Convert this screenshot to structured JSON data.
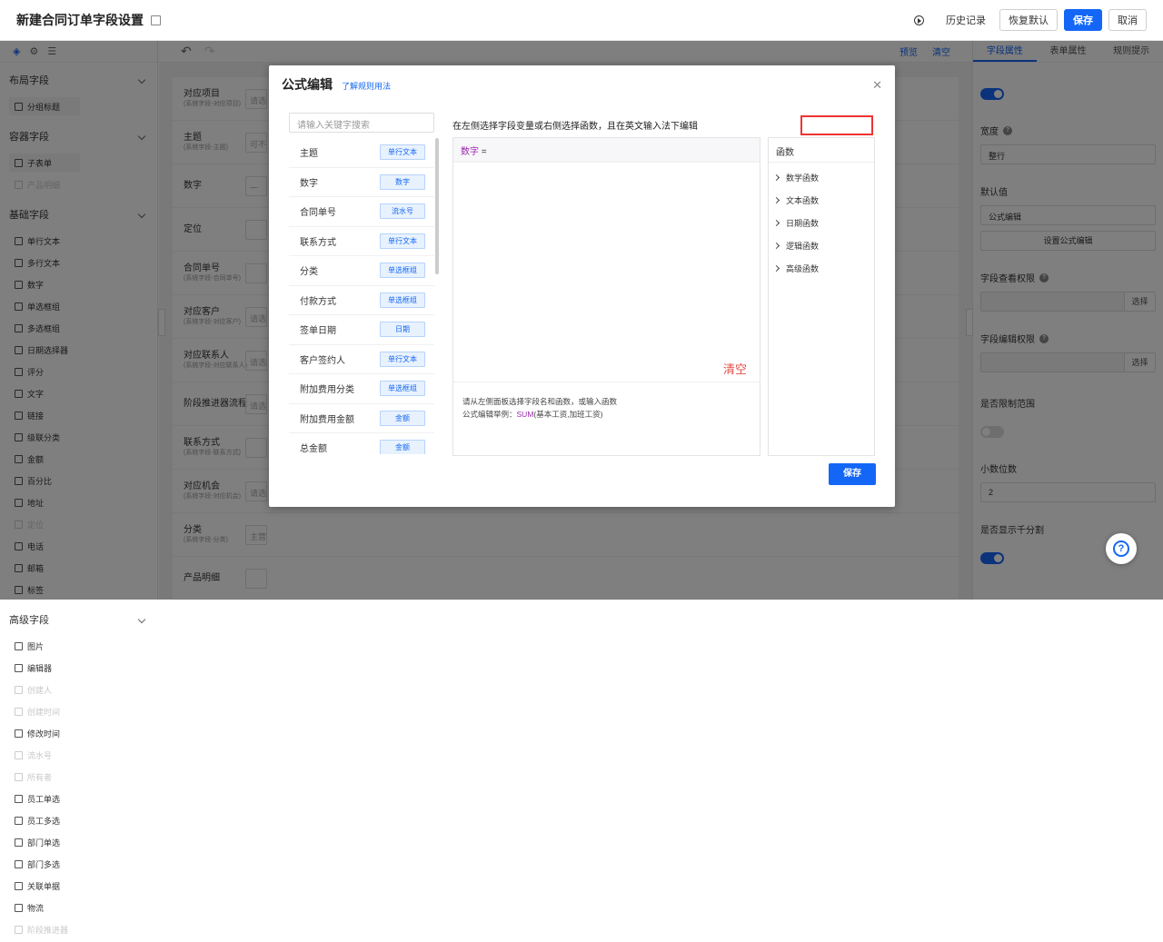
{
  "header": {
    "title": "新建合同订单字段设置",
    "history": "历史记录",
    "restore": "恢复默认",
    "save": "保存",
    "cancel": "取消"
  },
  "left_panel": {
    "groups": [
      {
        "title": "布局字段",
        "items": [
          "分组标题"
        ]
      },
      {
        "title": "容器字段",
        "items": [
          "子表单",
          "产品明细"
        ]
      },
      {
        "title": "基础字段",
        "items": [
          "单行文本",
          "多行文本",
          "数字",
          "单选框组",
          "多选框组",
          "日期选择器",
          "评分",
          "文字",
          "链接",
          "级联分类",
          "金额",
          "百分比",
          "地址",
          "定位",
          "电话",
          "邮箱",
          "标签"
        ]
      },
      {
        "title": "高级字段",
        "items": [
          "图片",
          "编辑器",
          "创建人",
          "创建时间",
          "修改时间",
          "流水号",
          "所有者",
          "员工单选",
          "员工多选",
          "部门单选",
          "部门多选",
          "关联单据",
          "物流",
          "阶段推进器"
        ]
      }
    ]
  },
  "toolbar": {
    "preview": "预览",
    "clear": "清空"
  },
  "form_rows": [
    {
      "label": "对应项目",
      "sub": "(系统字段-对应项目)",
      "value": "请选"
    },
    {
      "label": "主题",
      "sub": "(系统字段-主题)",
      "value": "可不"
    },
    {
      "label": "数字",
      "sub": "",
      "value": "一"
    },
    {
      "label": "定位",
      "sub": "",
      "value": ""
    },
    {
      "label": "合同单号",
      "sub": "(系统字段-合同单号)",
      "value": ""
    },
    {
      "label": "对应客户",
      "sub": "(系统字段-对应客户)",
      "value": "请选"
    },
    {
      "label": "对应联系人",
      "sub": "(系统字段-对应联系人)",
      "value": "请选"
    },
    {
      "label": "阶段推进器流程",
      "sub": "",
      "value": "请选"
    },
    {
      "label": "联系方式",
      "sub": "(系统字段-联系方式)",
      "value": ""
    },
    {
      "label": "对应机会",
      "sub": "(系统字段-对应机会)",
      "value": "请选择"
    },
    {
      "label": "分类",
      "sub": "(系统字段-分类)",
      "value": "主营产品销售"
    },
    {
      "label": "产品明细",
      "sub": "",
      "value": ""
    }
  ],
  "right_panel": {
    "tabs": [
      "字段属性",
      "表单属性",
      "规则提示"
    ],
    "width_label": "宽度",
    "width_value": "整行",
    "default_label": "默认值",
    "default_value": "公式编辑",
    "set_formula": "设置公式编辑",
    "view_perm": "字段查看权限",
    "edit_perm": "字段编辑权限",
    "pick": "选择",
    "limit_label": "是否限制范围",
    "decimal_label": "小数位数",
    "decimal_value": "2",
    "thousands_label": "是否显示千分割"
  },
  "modal": {
    "title": "公式编辑",
    "help_link": "了解规则用法",
    "search_placeholder": "请输入关键字搜索",
    "hint": "在左侧选择字段变量或右侧选择函数，且在英文输入法下编辑",
    "formula_var": "数字",
    "formula_eq": "=",
    "clear": "清空",
    "help_line1": "请从左侧面板选择字段名和函数，或输入函数",
    "help_line2_prefix": "公式编辑举例：",
    "help_line2_fx": "SUM",
    "help_line2_args": "(基本工资,加班工资)",
    "func_header": "函数",
    "func_list": [
      "数学函数",
      "文本函数",
      "日期函数",
      "逻辑函数",
      "高级函数"
    ],
    "fields": [
      {
        "name": "主题",
        "type": "单行文本"
      },
      {
        "name": "数字",
        "type": "数字"
      },
      {
        "name": "合同单号",
        "type": "流水号"
      },
      {
        "name": "联系方式",
        "type": "单行文本"
      },
      {
        "name": "分类",
        "type": "单选框组"
      },
      {
        "name": "付款方式",
        "type": "单选框组"
      },
      {
        "name": "签单日期",
        "type": "日期"
      },
      {
        "name": "客户签约人",
        "type": "单行文本"
      },
      {
        "name": "附加费用分类",
        "type": "单选框组"
      },
      {
        "name": "附加费用金额",
        "type": "金额"
      },
      {
        "name": "总金额",
        "type": "金额"
      }
    ],
    "save": "保存"
  },
  "colors": {
    "accent": "#1467f6",
    "danger": "#e0504a",
    "formula": "#9b27af"
  }
}
